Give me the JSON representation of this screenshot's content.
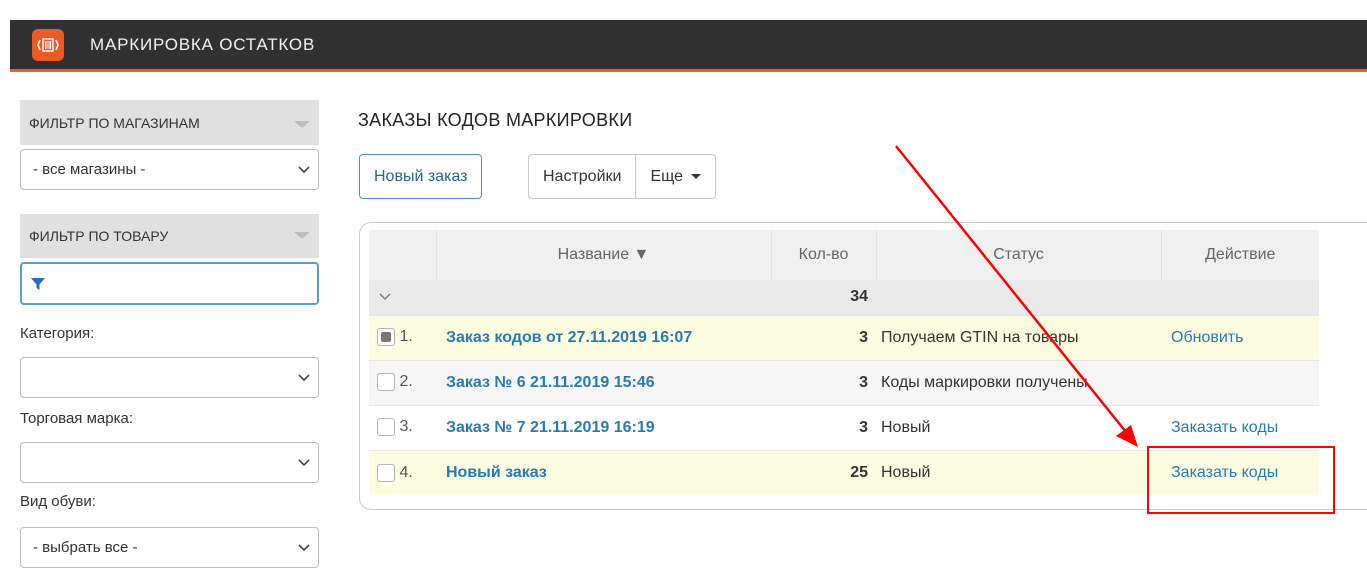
{
  "header": {
    "title": "МАРКИРОВКА ОСТАТКОВ",
    "logo_icon": "barcode-icon",
    "accent": "#ee5a24"
  },
  "sidebar": {
    "shop_filter": {
      "title": "ФИЛЬТР ПО МАГАЗИНАМ",
      "value": "- все магазины -"
    },
    "product_filter": {
      "title": "ФИЛЬТР ПО ТОВАРУ",
      "search_icon": "filter-icon",
      "search_value": ""
    },
    "category": {
      "label": "Категория:",
      "value": ""
    },
    "brand": {
      "label": "Торговая марка:",
      "value": ""
    },
    "shoe_type": {
      "label": "Вид обуви:",
      "value": "- выбрать все -"
    }
  },
  "main": {
    "title": "ЗАКАЗЫ КОДОВ МАРКИРОВКИ",
    "buttons": {
      "new_order": "Новый заказ",
      "settings": "Настройки",
      "more": "Еще"
    },
    "table": {
      "columns": {
        "name": "Название ▼",
        "qty": "Кол-во",
        "status": "Статус",
        "action": "Действие"
      },
      "group_total": "34",
      "rows": [
        {
          "num": "1.",
          "name": "Заказ кодов от 27.11.2019 16:07",
          "qty": "3",
          "status": "Получаем GTIN на товары",
          "action": "Обновить"
        },
        {
          "num": "2.",
          "name": "Заказ № 6 21.11.2019 15:46",
          "qty": "3",
          "status": "Коды маркировки получены",
          "action": ""
        },
        {
          "num": "3.",
          "name": "Заказ № 7 21.11.2019 16:19",
          "qty": "3",
          "status": "Новый",
          "action": "Заказать коды"
        },
        {
          "num": "4.",
          "name": "Новый заказ",
          "qty": "25",
          "status": "Новый",
          "action": "Заказать коды"
        }
      ]
    }
  }
}
